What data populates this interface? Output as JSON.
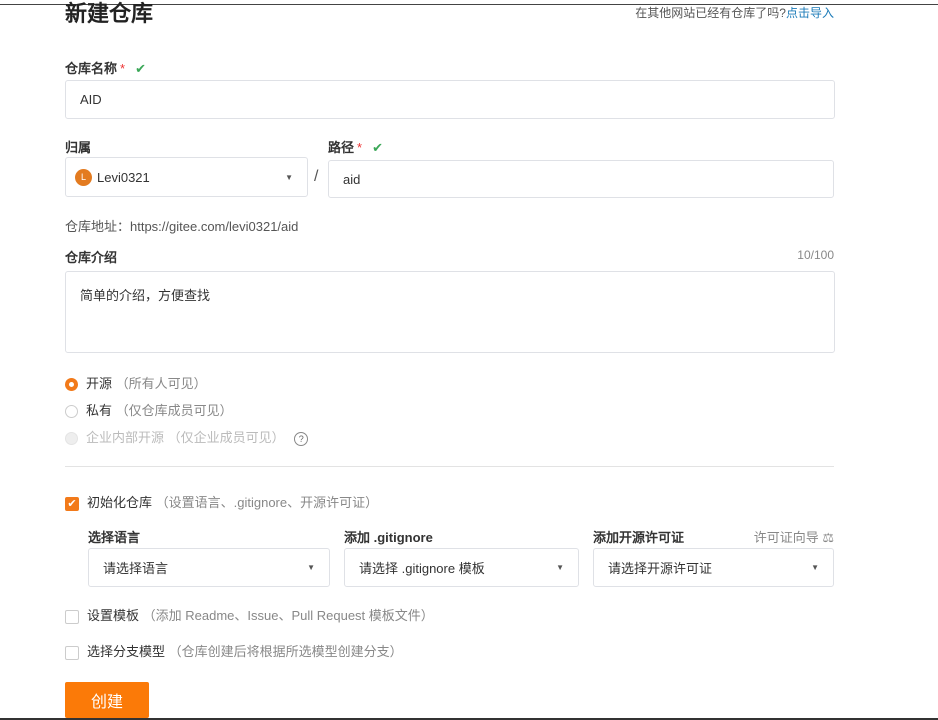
{
  "title": "新建仓库",
  "import_prompt": "在其他网站已经有仓库了吗?",
  "import_link": "点击导入",
  "name": {
    "label": "仓库名称",
    "required": "*",
    "value": "AID"
  },
  "owner": {
    "label": "归属",
    "avatar_letter": "L",
    "value": "Levi0321"
  },
  "separator": "/",
  "path": {
    "label": "路径",
    "required": "*",
    "value": "aid"
  },
  "address": "仓库地址：https://gitee.com/levi0321/aid",
  "intro": {
    "label": "仓库介绍",
    "counter": "10/100",
    "value": "简单的介绍，方便查找"
  },
  "visibility": [
    {
      "label": "开源",
      "hint": "（所有人可见）",
      "selected": true
    },
    {
      "label": "私有",
      "hint": "（仅仓库成员可见）",
      "selected": false
    },
    {
      "label": "企业内部开源",
      "hint": "（仅企业成员可见）",
      "disabled": true
    }
  ],
  "help_icon": "?",
  "init": {
    "label": "初始化仓库",
    "hint": "（设置语言、.gitignore、开源许可证）",
    "checked": true
  },
  "language": {
    "label": "选择语言",
    "placeholder": "请选择语言"
  },
  "gitignore": {
    "label": "添加 .gitignore",
    "placeholder": "请选择 .gitignore 模板"
  },
  "license": {
    "label": "添加开源许可证",
    "guide": "许可证向导",
    "placeholder": "请选择开源许可证"
  },
  "template": {
    "label": "设置模板",
    "hint": "（添加 Readme、Issue、Pull Request 模板文件）",
    "checked": false
  },
  "branch": {
    "label": "选择分支模型",
    "hint": "（仓库创建后将根据所选模型创建分支）",
    "checked": false
  },
  "submit": "创建",
  "colors": {
    "accent": "#fb7a08",
    "check": "#3aa757",
    "link": "#1b7bb8"
  }
}
